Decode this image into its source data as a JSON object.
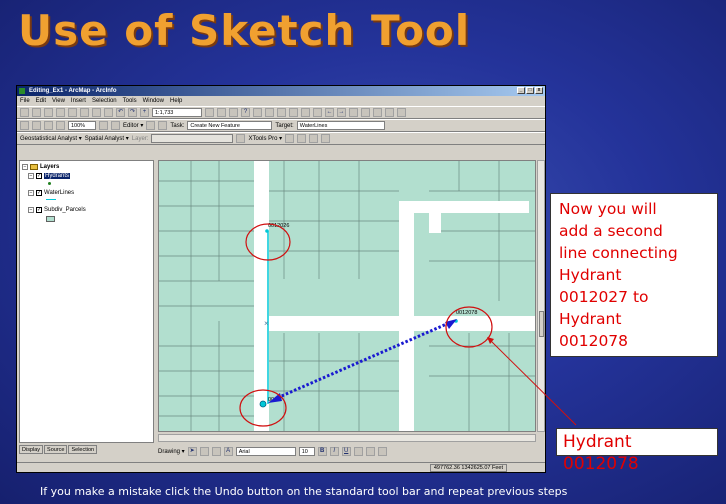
{
  "slide": {
    "title": "Use of Sketch Tool",
    "footer": "If you make a mistake click the Undo button  on the standard tool bar and repeat previous  steps"
  },
  "window": {
    "title": "Editing_Ex1 - ArcMap - ArcInfo",
    "controls": [
      "_",
      "□",
      "x"
    ]
  },
  "menu": [
    "File",
    "Edit",
    "View",
    "Insert",
    "Selection",
    "Tools",
    "Window",
    "Help"
  ],
  "standard_toolbar": {
    "scale": "1:1,733"
  },
  "editor_toolbar": {
    "zoom": "100%",
    "editor_label": "Editor ▾",
    "task_label": "Task:",
    "task_value": "Create New Feature",
    "target_label": "Target:",
    "target_value": "WaterLines"
  },
  "analyst_toolbar": {
    "geostat": "Geostatistical Analyst ▾",
    "spatial": "Spatial Analyst ▾",
    "layer_label": "Layer:",
    "xtools": "XTools Pro ▾"
  },
  "toc": {
    "root": "Layers",
    "layers": [
      "Hydrants",
      "WaterLines",
      "Subdiv_Parcels"
    ],
    "tabs": [
      "Display",
      "Source",
      "Selection"
    ]
  },
  "drawing_toolbar": {
    "drawing": "Drawing ▾",
    "font": "Arial",
    "size": "10",
    "bold": "B",
    "italic": "I",
    "underline": "U",
    "text_tool": "A"
  },
  "status": {
    "coords": "497762.36  1342625.07 Feet"
  },
  "map": {
    "labels": [
      "0012026",
      "0012078",
      "0012"
    ]
  },
  "callouts": {
    "instruction_lines": [
      "Now you will",
      "add a second",
      "line connecting",
      "Hydrant",
      "0012027 to",
      "Hydrant",
      "0012078"
    ],
    "hydrant": "Hydrant 0012078"
  },
  "colors": {
    "title": "#f0a030",
    "callout_text": "#e00000",
    "map_parcel": "#b2dfcf",
    "sketch_line": "#1a1ad0",
    "waterline": "#00c8d8"
  }
}
